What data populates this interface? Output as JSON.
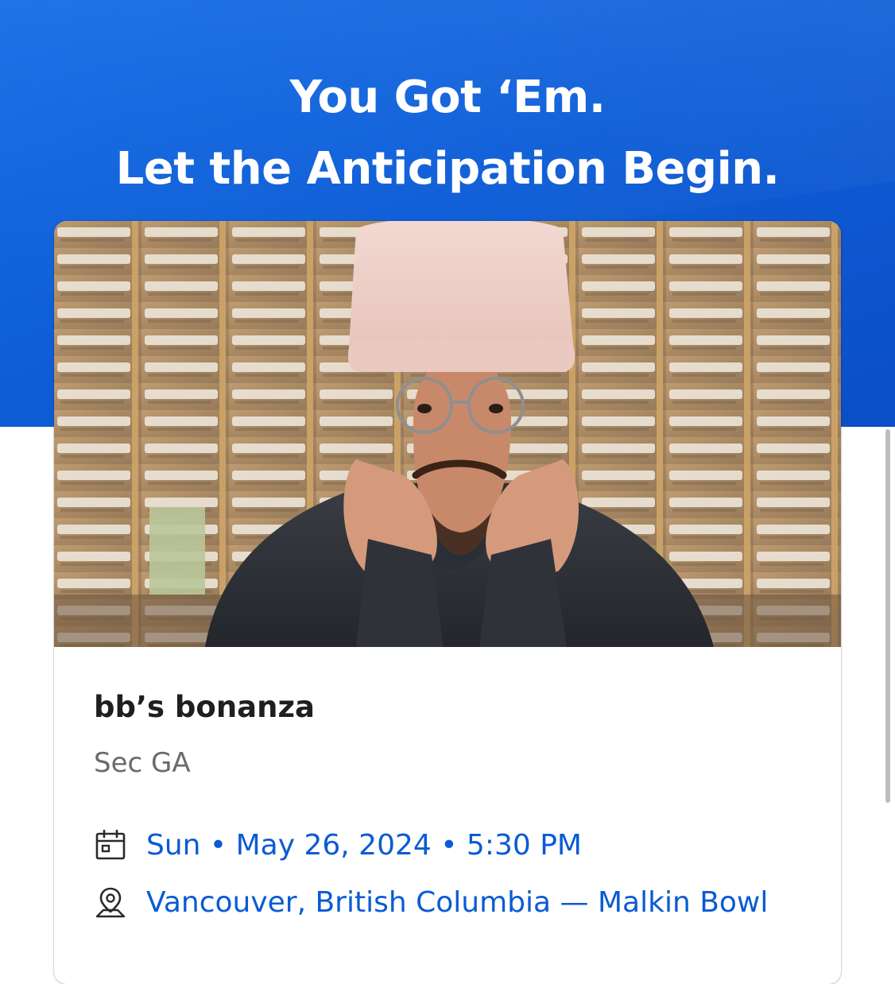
{
  "hero": {
    "headline_line1": "You Got ‘Em.",
    "headline_line2": "Let the Anticipation Begin.",
    "band_color": "#0f5fd8"
  },
  "event": {
    "title": "bb’s bonanza",
    "section": "Sec GA",
    "date_text": "Sun • May 26, 2024 • 5:30 PM",
    "venue_text": "Vancouver, British Columbia — Malkin Bowl",
    "link_color": "#0a5bd3",
    "photo_description": "event-artist-photo"
  },
  "icons": {
    "date": "calendar-icon",
    "venue": "location-pin-icon"
  }
}
